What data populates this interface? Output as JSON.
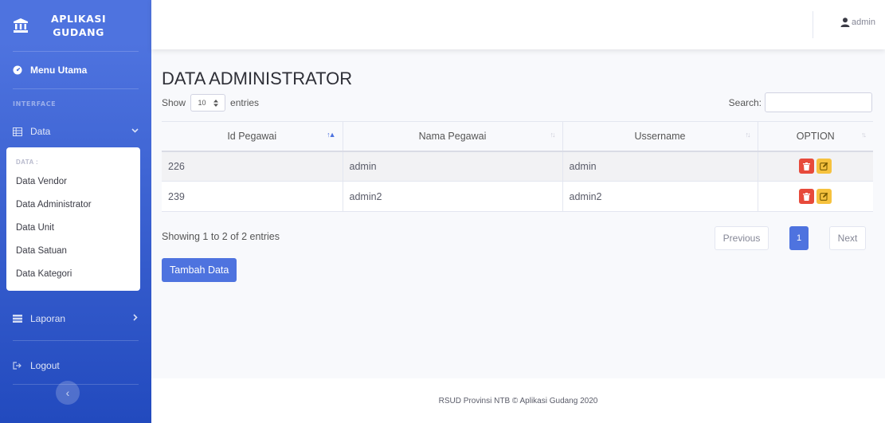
{
  "sidebar": {
    "brand_line1": "APLIKASI",
    "brand_line2": "GUDANG",
    "dashboard_label": "Menu Utama",
    "heading": "INTERFACE",
    "data_label": "Data",
    "collapse_header": "DATA :",
    "collapse_items": [
      "Data Vendor",
      "Data Administrator",
      "Data Unit",
      "Data Satuan",
      "Data Kategori"
    ],
    "laporan_label": "Laporan",
    "logout_label": "Logout",
    "toggle_glyph": "‹",
    "colors": {
      "gradient_top": "#4e73df",
      "gradient_bottom": "#224abe"
    },
    "icons": [
      "bank-icon",
      "tachometer-icon",
      "table-icon",
      "chevron-down-icon",
      "list-icon",
      "chevron-right-icon",
      "logout-icon",
      "chevron-left-icon"
    ]
  },
  "topbar": {
    "user_name": "admin",
    "icon": "user-icon"
  },
  "main": {
    "title": "DATA ADMINISTRATOR",
    "show_label": "Show",
    "entries_value": "10",
    "entries_label": "entries",
    "search_label": "Search:",
    "search_value": "",
    "columns": [
      "Id Pegawai",
      "Nama Pegawai",
      "Ussername",
      "OPTION"
    ],
    "rows": [
      {
        "id": "226",
        "nama": "admin",
        "username": "admin"
      },
      {
        "id": "239",
        "nama": "admin2",
        "username": "admin2"
      }
    ],
    "info": "Showing 1 to 2 of 2 entries",
    "pager": {
      "previous": "Previous",
      "current": "1",
      "next": "Next"
    },
    "add_button": "Tambah Data",
    "colors": {
      "primary": "#4e73df",
      "danger": "#e74a3b",
      "warning": "#f6c23e"
    }
  },
  "footer": {
    "text": "RSUD Provinsi NTB © Aplikasi Gudang 2020"
  }
}
